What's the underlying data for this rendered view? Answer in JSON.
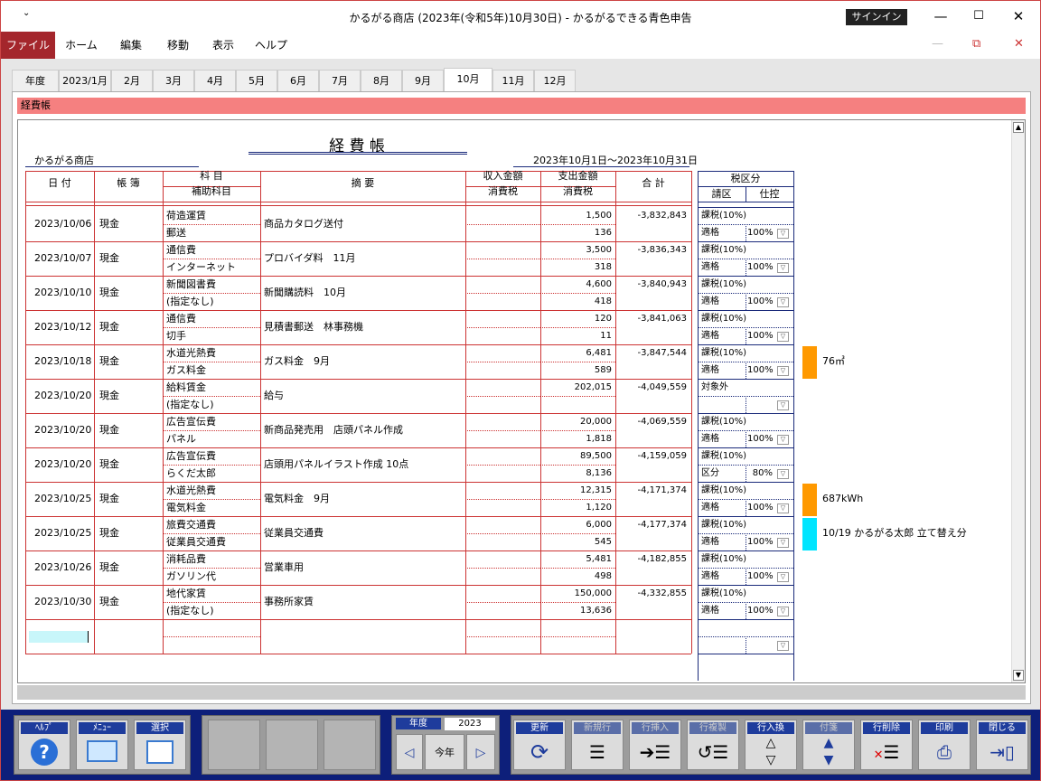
{
  "window": {
    "title": "かるがる商店 (2023年(令和5年)10月30日)  -  かるがるできる青色申告",
    "signin": "サインイン",
    "min": "—",
    "max": "☐",
    "close": "✕",
    "min2": "—",
    "restore": "⧉",
    "close2": "✕",
    "ribbon_icon": "chevron-down-icon"
  },
  "menu": {
    "file": "ファイル",
    "home": "ホーム",
    "edit": "編集",
    "move": "移動",
    "view": "表示",
    "help": "ヘルプ"
  },
  "tabs": [
    "年度",
    "2023/1月",
    "2月",
    "3月",
    "4月",
    "5月",
    "6月",
    "7月",
    "8月",
    "9月",
    "10月",
    "11月",
    "12月"
  ],
  "active_tab": "10月",
  "banner": "経費帳",
  "sheet": {
    "title": "経 費 帳",
    "shop": "かるがる商店",
    "period": "2023年10月1日～2023年10月31日"
  },
  "headers": {
    "date": "日 付",
    "book": "帳 簿",
    "account": "科 目",
    "sub_account": "補助科目",
    "desc": "摘      要",
    "income": "収入金額",
    "income_tax": "消費税",
    "expense": "支出金額",
    "expense_tax": "消費税",
    "total": "合 計",
    "tax_cat": "税区分",
    "tax_sales": "請区",
    "tax_purchase": "仕控"
  },
  "rows": [
    {
      "date": "2023/10/06",
      "book": "現金",
      "account": "荷造運賃",
      "sub": "郵送",
      "desc": "商品カタログ送付",
      "expense": "1,500",
      "tax": "136",
      "total": "-3,832,843",
      "cat": "課税(10%)",
      "sales": "適格",
      "pct": "100%",
      "note": ""
    },
    {
      "date": "2023/10/07",
      "book": "現金",
      "account": "通信費",
      "sub": "インターネット",
      "desc": "プロバイダ料　11月",
      "expense": "3,500",
      "tax": "318",
      "total": "-3,836,343",
      "cat": "課税(10%)",
      "sales": "適格",
      "pct": "100%",
      "note": ""
    },
    {
      "date": "2023/10/10",
      "book": "現金",
      "account": "新聞図書費",
      "sub": "(指定なし)",
      "desc": "新聞購読料　10月",
      "expense": "4,600",
      "tax": "418",
      "total": "-3,840,943",
      "cat": "課税(10%)",
      "sales": "適格",
      "pct": "100%",
      "note": ""
    },
    {
      "date": "2023/10/12",
      "book": "現金",
      "account": "通信費",
      "sub": "切手",
      "desc": "見積書郵送　林事務機",
      "expense": "120",
      "tax": "11",
      "total": "-3,841,063",
      "cat": "課税(10%)",
      "sales": "適格",
      "pct": "100%",
      "note": ""
    },
    {
      "date": "2023/10/18",
      "book": "現金",
      "account": "水道光熱費",
      "sub": "ガス料金",
      "desc": "ガス料金　9月",
      "expense": "6,481",
      "tax": "589",
      "total": "-3,847,544",
      "cat": "課税(10%)",
      "sales": "適格",
      "pct": "100%",
      "note": "76㎥",
      "note_color": "#ff9900"
    },
    {
      "date": "2023/10/20",
      "book": "現金",
      "account": "給料賃金",
      "sub": "(指定なし)",
      "desc": "給与",
      "expense": "202,015",
      "tax": "",
      "total": "-4,049,559",
      "cat": "対象外",
      "sales": "",
      "pct": "",
      "note": ""
    },
    {
      "date": "2023/10/20",
      "book": "現金",
      "account": "広告宣伝費",
      "sub": "パネル",
      "desc": "新商品発売用　店頭パネル作成",
      "expense": "20,000",
      "tax": "1,818",
      "total": "-4,069,559",
      "cat": "課税(10%)",
      "sales": "適格",
      "pct": "100%",
      "note": ""
    },
    {
      "date": "2023/10/20",
      "book": "現金",
      "account": "広告宣伝費",
      "sub": "らくだ太郎",
      "desc": "店頭用パネルイラスト作成 10点",
      "expense": "89,500",
      "tax": "8,136",
      "total": "-4,159,059",
      "cat": "課税(10%)",
      "sales": "区分",
      "pct": "80%",
      "note": ""
    },
    {
      "date": "2023/10/25",
      "book": "現金",
      "account": "水道光熱費",
      "sub": "電気料金",
      "desc": "電気料金　9月",
      "expense": "12,315",
      "tax": "1,120",
      "total": "-4,171,374",
      "cat": "課税(10%)",
      "sales": "適格",
      "pct": "100%",
      "note": "687kWh",
      "note_color": "#ff9900"
    },
    {
      "date": "2023/10/25",
      "book": "現金",
      "account": "旅費交通費",
      "sub": "従業員交通費",
      "desc": "従業員交通費",
      "expense": "6,000",
      "tax": "545",
      "total": "-4,177,374",
      "cat": "課税(10%)",
      "sales": "適格",
      "pct": "100%",
      "note": "10/19 かるがる太郎 立て替え分",
      "note_color": "#00e5ff"
    },
    {
      "date": "2023/10/26",
      "book": "現金",
      "account": "消耗品費",
      "sub": "ガソリン代",
      "desc": "営業車用",
      "expense": "5,481",
      "tax": "498",
      "total": "-4,182,855",
      "cat": "課税(10%)",
      "sales": "適格",
      "pct": "100%",
      "note": ""
    },
    {
      "date": "2023/10/30",
      "book": "現金",
      "account": "地代家賃",
      "sub": "(指定なし)",
      "desc": "事務所家賃",
      "expense": "150,000",
      "tax": "13,636",
      "total": "-4,332,855",
      "cat": "課税(10%)",
      "sales": "適格",
      "pct": "100%",
      "note": ""
    }
  ],
  "colors": {
    "accent": "#a4262c",
    "banner": "#f58080",
    "grid_red": "#cc3333",
    "grid_blue": "#1a2a7a",
    "toolbar": "#0d1f7a"
  },
  "toolbar": {
    "help": "ﾍﾙﾌﾟ",
    "menu": "ﾒﾆｭｰ",
    "select": "選択",
    "year_label": "年度",
    "year_value": "2023",
    "this_year": "今年",
    "update": "更新",
    "new_row": "新規行",
    "insert_row": "行挿入",
    "copy_row": "行複製",
    "swap_row": "行入換",
    "memo": "付箋",
    "delete_row": "行削除",
    "print": "印刷",
    "close": "閉じる"
  }
}
